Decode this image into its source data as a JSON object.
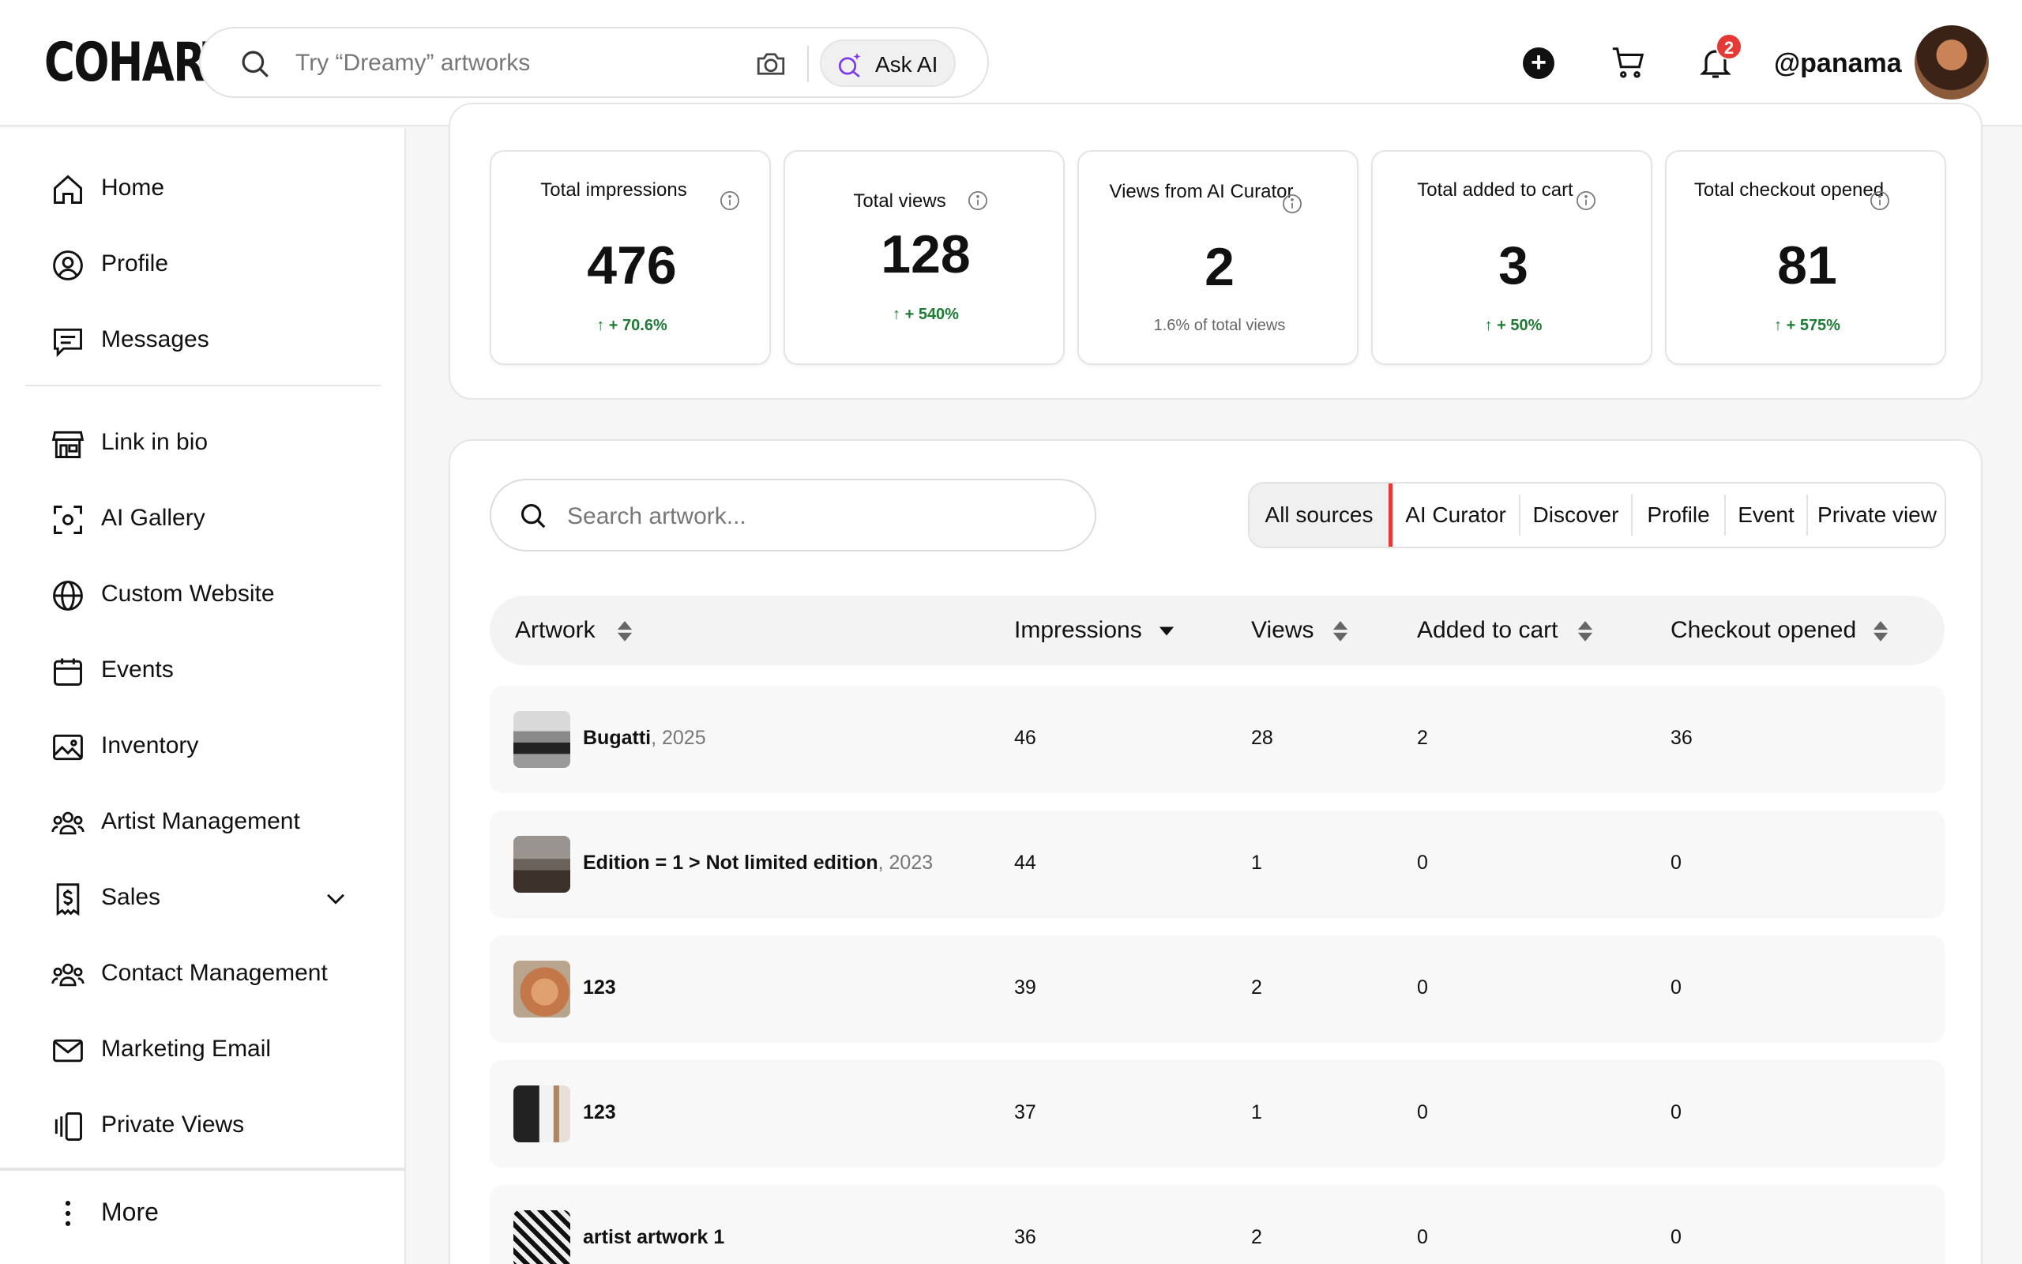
{
  "brand": {
    "logo": "COHART"
  },
  "top_search": {
    "placeholder": "Try “Dreamy” artworks",
    "ask_ai_label": "Ask AI"
  },
  "header": {
    "notification_count": "2",
    "username": "@panama"
  },
  "sidebar": {
    "items": [
      {
        "label": "Home",
        "icon": "home-icon"
      },
      {
        "label": "Profile",
        "icon": "user-circle-icon"
      },
      {
        "label": "Messages",
        "icon": "message-icon"
      },
      {
        "label": "Link in bio",
        "icon": "storefront-icon"
      },
      {
        "label": "AI Gallery",
        "icon": "scan-icon"
      },
      {
        "label": "Custom Website",
        "icon": "globe-icon"
      },
      {
        "label": "Events",
        "icon": "calendar-icon"
      },
      {
        "label": "Inventory",
        "icon": "image-icon"
      },
      {
        "label": "Artist Management",
        "icon": "users-icon"
      },
      {
        "label": "Sales",
        "icon": "dollar-doc-icon"
      },
      {
        "label": "Contact Management",
        "icon": "contacts-icon"
      },
      {
        "label": "Marketing Email",
        "icon": "mail-icon"
      },
      {
        "label": "Private Views",
        "icon": "private-views-icon"
      }
    ],
    "more_label": "More"
  },
  "stats": [
    {
      "title": "Total impressions",
      "value": "476",
      "change": "+ 70.6%",
      "trend": "up"
    },
    {
      "title": "Total views",
      "value": "128",
      "change": "+ 540%",
      "trend": "up"
    },
    {
      "title": "Views from AI Curator",
      "value": "2",
      "change": "1.6% of total views",
      "trend": "none"
    },
    {
      "title": "Total added to cart",
      "value": "3",
      "change": "+ 50%",
      "trend": "up"
    },
    {
      "title": "Total checkout opened",
      "value": "81",
      "change": "+ 575%",
      "trend": "up"
    }
  ],
  "artwork_search": {
    "placeholder": "Search artwork..."
  },
  "source_tabs": [
    "All sources",
    "AI Curator",
    "Discover",
    "Profile",
    "Event",
    "Private view"
  ],
  "active_tab": "All sources",
  "table": {
    "headers": [
      "Artwork",
      "Impressions",
      "Views",
      "Added to cart",
      "Checkout opened"
    ],
    "rows": [
      {
        "name": "Bugatti",
        "year": ", 2025",
        "impressions": "46",
        "views": "28",
        "added": "2",
        "checkout": "36"
      },
      {
        "name": "Edition = 1 > Not limited edition",
        "year": ", 2023",
        "impressions": "44",
        "views": "1",
        "added": "0",
        "checkout": "0"
      },
      {
        "name": "123",
        "year": "",
        "impressions": "39",
        "views": "2",
        "added": "0",
        "checkout": "0"
      },
      {
        "name": "123",
        "year": "",
        "impressions": "37",
        "views": "1",
        "added": "0",
        "checkout": "0"
      },
      {
        "name": "artist artwork 1",
        "year": "",
        "impressions": "36",
        "views": "2",
        "added": "0",
        "checkout": "0"
      }
    ]
  },
  "colors": {
    "accent_green": "#1f7a35",
    "badge_red": "#e53935",
    "tab_marker": "#e53935"
  }
}
